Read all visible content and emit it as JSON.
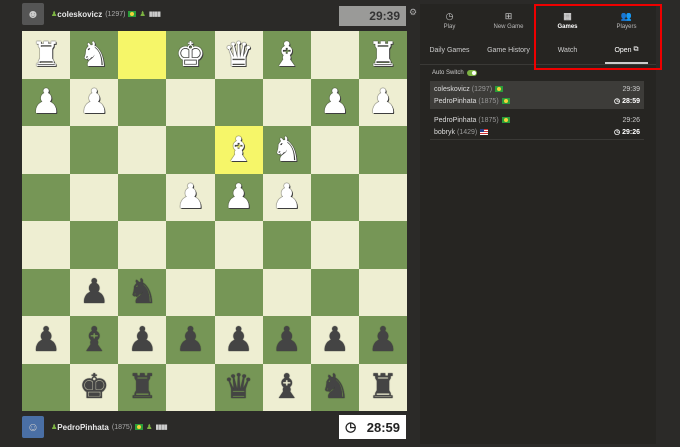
{
  "top_player": {
    "name": "coleskovicz",
    "rating": "(1297)",
    "clock": "29:39"
  },
  "bottom_player": {
    "name": "PedroPinhata",
    "rating": "(1875)",
    "clock": "28:59"
  },
  "board": [
    [
      "wR",
      "wN",
      "",
      "wK",
      "wQ",
      "wB",
      "",
      "wR"
    ],
    [
      "wP",
      "wP",
      "",
      "",
      "",
      "",
      "wP",
      "wP"
    ],
    [
      "",
      "",
      "",
      "",
      "wB",
      "wN",
      "",
      ""
    ],
    [
      "",
      "",
      "",
      "wP",
      "wP",
      "wP",
      "",
      ""
    ],
    [
      "",
      "",
      "",
      "",
      "",
      "",
      "",
      ""
    ],
    [
      "",
      "bP",
      "bN",
      "",
      "",
      "",
      "",
      ""
    ],
    [
      "bP",
      "bB",
      "bP",
      "bP",
      "bP",
      "bP",
      "bP",
      "bP"
    ],
    [
      "",
      "bK",
      "bR",
      "",
      "bQ",
      "bB",
      "bN",
      "bR"
    ]
  ],
  "highlight": [
    "0-2",
    "2-4"
  ],
  "nav": {
    "play": "Play",
    "new_game": "New Game",
    "games": "Games",
    "players": "Players"
  },
  "subnav": {
    "daily": "Daily Games",
    "history": "Game History",
    "watch": "Watch",
    "open": "Open"
  },
  "autoswitch": "Auto Switch",
  "games": [
    {
      "p1": "coleskovicz",
      "r1": "(1297)",
      "t1": "29:39",
      "p2": "PedroPinhata",
      "r2": "(1875)",
      "t2": "28:59"
    },
    {
      "p1": "PedroPinhata",
      "r1": "(1875)",
      "t1": "29:26",
      "p2": "bobryk",
      "r2": "(1429)",
      "t2": "29:26"
    }
  ],
  "colors": {
    "light": "#eeeed2",
    "dark": "#769656",
    "highlight_box": "#ee0000"
  }
}
